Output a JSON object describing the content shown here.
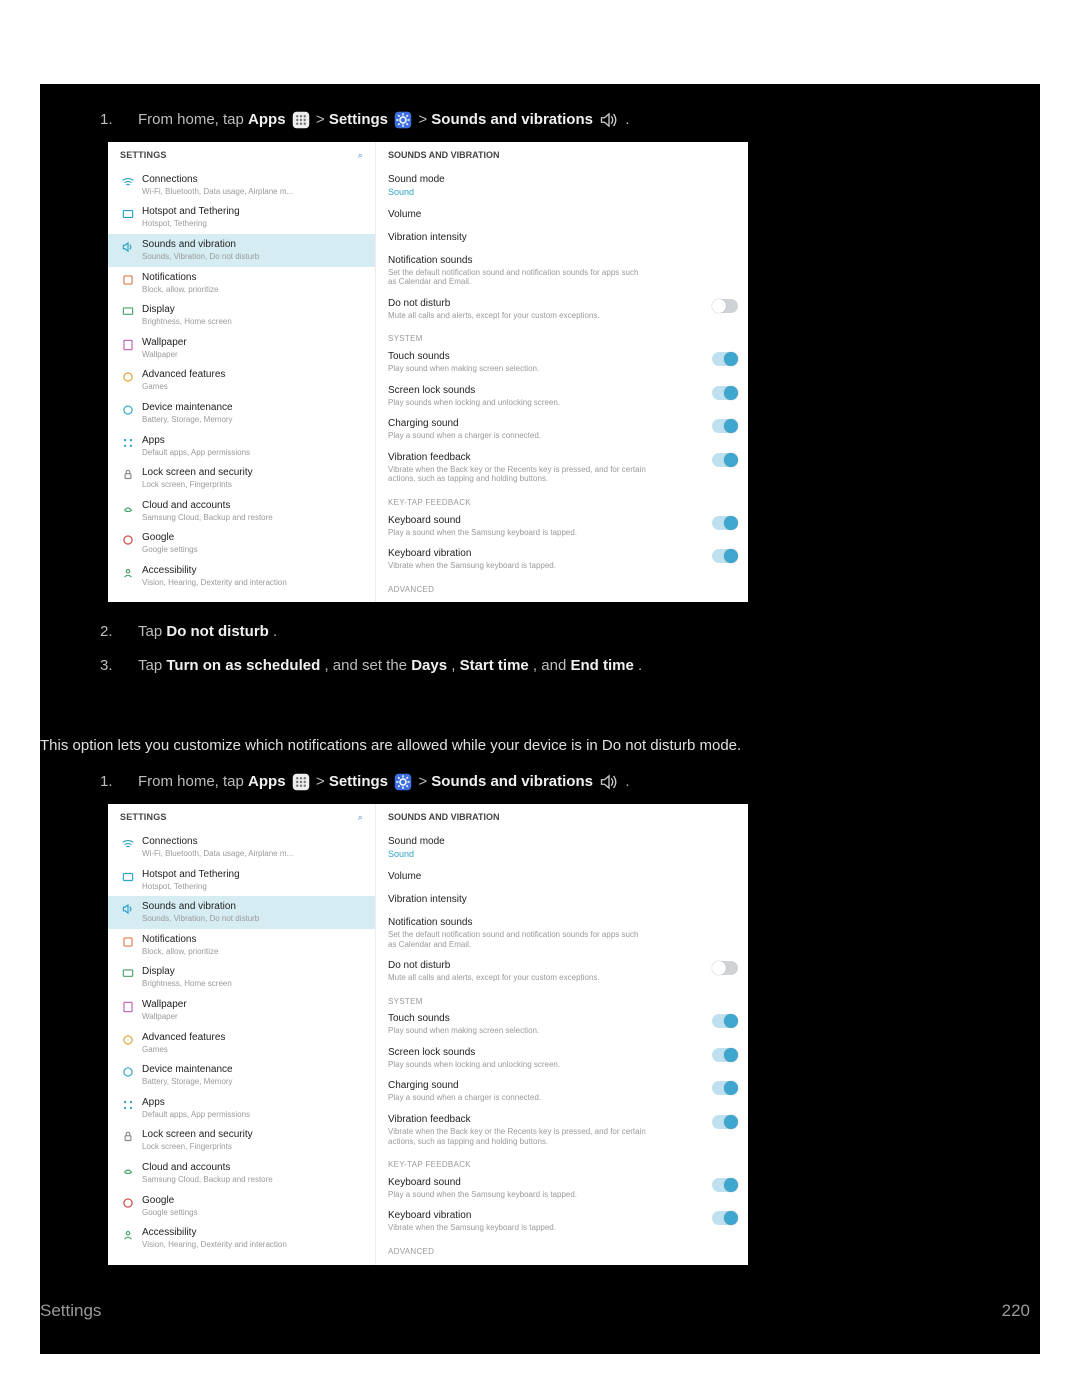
{
  "step1": {
    "num": "1.",
    "lead": "From home, tap ",
    "apps": "Apps",
    "gt1": " > ",
    "settings": "Settings",
    "gt2": " > ",
    "sv": "Sounds and vibrations",
    "tail": "."
  },
  "step2": {
    "num": "2.",
    "lead": "Tap ",
    "bold": "Do not disturb",
    "tail": "."
  },
  "step3": {
    "num": "3.",
    "lead": "Tap ",
    "b1": "Turn on as scheduled",
    "mid1": ", and set the ",
    "b2": "Days",
    "mid2": ", ",
    "b3": "Start time",
    "mid3": ", and ",
    "b4": "End time",
    "tail": "."
  },
  "para": "This option lets you customize which notifications are allowed while your device is in Do not disturb mode.",
  "mock": {
    "left_title": "SETTINGS",
    "right_title": "SOUNDS AND VIBRATION",
    "items": [
      {
        "t": "Connections",
        "s": "Wi-Fi, Bluetooth, Data usage, Airplane m..."
      },
      {
        "t": "Hotspot and Tethering",
        "s": "Hotspot, Tethering"
      },
      {
        "t": "Sounds and vibration",
        "s": "Sounds, Vibration, Do not disturb"
      },
      {
        "t": "Notifications",
        "s": "Block, allow, prioritize"
      },
      {
        "t": "Display",
        "s": "Brightness, Home screen"
      },
      {
        "t": "Wallpaper",
        "s": "Wallpaper"
      },
      {
        "t": "Advanced features",
        "s": "Games"
      },
      {
        "t": "Device maintenance",
        "s": "Battery, Storage, Memory"
      },
      {
        "t": "Apps",
        "s": "Default apps, App permissions"
      },
      {
        "t": "Lock screen and security",
        "s": "Lock screen, Fingerprints"
      },
      {
        "t": "Cloud and accounts",
        "s": "Samsung Cloud, Backup and restore"
      },
      {
        "t": "Google",
        "s": "Google settings"
      },
      {
        "t": "Accessibility",
        "s": "Vision, Hearing, Dexterity and interaction"
      }
    ],
    "right": {
      "sound_mode": {
        "t": "Sound mode",
        "v": "Sound"
      },
      "volume": "Volume",
      "vibint": "Vibration intensity",
      "notif": {
        "t": "Notification sounds",
        "s": "Set the default notification sound and notification sounds for apps such as Calendar and Email."
      },
      "dnd": {
        "t": "Do not disturb",
        "s": "Mute all calls and alerts, except for your custom exceptions."
      },
      "sec_sys": "SYSTEM",
      "touch": {
        "t": "Touch sounds",
        "s": "Play sound when making screen selection."
      },
      "lock": {
        "t": "Screen lock sounds",
        "s": "Play sounds when locking and unlocking screen."
      },
      "charge": {
        "t": "Charging sound",
        "s": "Play a sound when a charger is connected."
      },
      "vibfb": {
        "t": "Vibration feedback",
        "s": "Vibrate when the Back key or the Recents key is pressed, and for certain actions, such as tapping and holding buttons."
      },
      "sec_key": "KEY-TAP FEEDBACK",
      "kbsound": {
        "t": "Keyboard sound",
        "s": "Play a sound when the Samsung keyboard is tapped."
      },
      "kbvib": {
        "t": "Keyboard vibration",
        "s": "Vibrate when the Samsung keyboard is tapped."
      },
      "advanced": "ADVANCED"
    }
  },
  "footer": {
    "left": "Settings",
    "right": "220"
  }
}
